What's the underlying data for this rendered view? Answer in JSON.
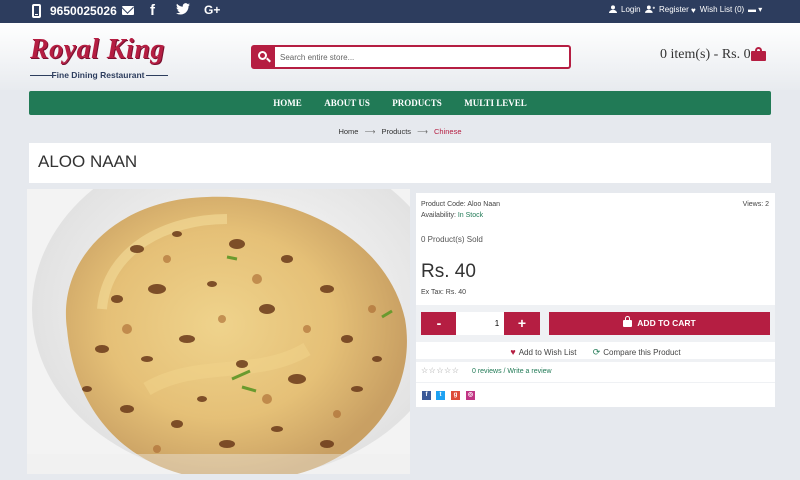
{
  "topbar": {
    "phone": "9650025026",
    "social_icons": [
      "mail-icon",
      "facebook-icon",
      "twitter-icon",
      "google-plus-icon"
    ],
    "links": {
      "login": "Login",
      "register": "Register",
      "wishlist": "Wish List (0)"
    }
  },
  "header": {
    "logo_title": "Royal King",
    "logo_subtitle": "Fine Dining Restaurant",
    "search_placeholder": "Search entire store...",
    "cart_summary": "0 item(s) - Rs. 0"
  },
  "nav": {
    "items": [
      "HOME",
      "ABOUT US",
      "PRODUCTS",
      "MULTI LEVEL"
    ]
  },
  "breadcrumb": {
    "items": [
      "Home",
      "Products",
      "Chinese"
    ]
  },
  "product": {
    "title": "ALOO NAAN",
    "code_label": "Product Code:",
    "code": "Aloo Naan",
    "availability_label": "Availability:",
    "availability": "In Stock",
    "views": "Views: 2",
    "sold": "0 Product(s) Sold",
    "price": "Rs. 40",
    "ex_tax": "Ex Tax: Rs. 40",
    "quantity": "1",
    "minus": "-",
    "plus": "+",
    "add_to_cart": "ADD TO CART",
    "wishlist": "Add to Wish List",
    "compare": "Compare this Product",
    "reviews": "0 reviews / Write a review",
    "rating": 0
  },
  "colors": {
    "topbar": "#2d3d5e",
    "brand": "#b51e42",
    "nav": "#217a56"
  }
}
